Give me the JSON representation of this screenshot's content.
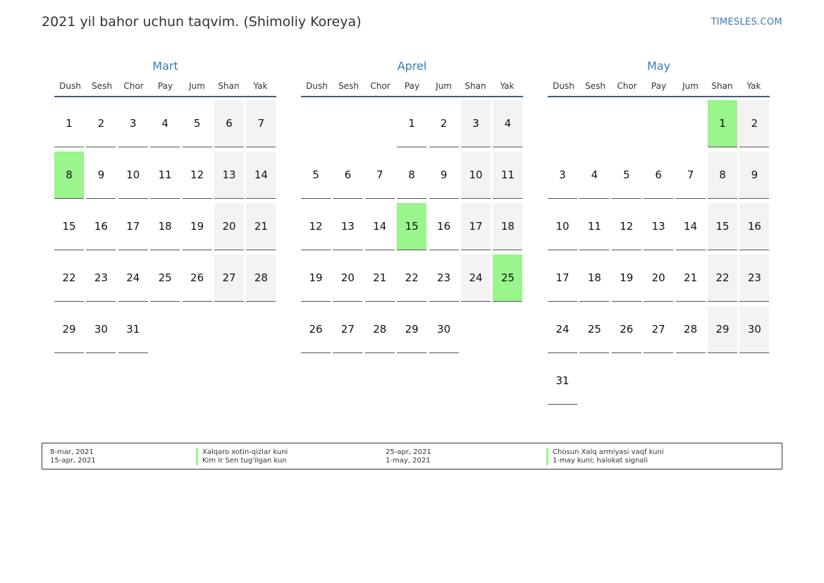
{
  "title": "2021 yil bahor uchun taqvim. (Shimoliy Koreya)",
  "site": "TIMESLES.COM",
  "colors": {
    "accent": "#3a7ab8",
    "holiday": "#99f58c",
    "weekend": "#f3f3f3"
  },
  "weekdays": [
    "Dush",
    "Sesh",
    "Chor",
    "Pay",
    "Jum",
    "Shan",
    "Yak"
  ],
  "months": [
    {
      "name": "Mart",
      "first_weekday": 0,
      "days": 31,
      "holidays": [
        8
      ]
    },
    {
      "name": "Aprel",
      "first_weekday": 3,
      "days": 30,
      "holidays": [
        15,
        25
      ]
    },
    {
      "name": "May",
      "first_weekday": 5,
      "days": 31,
      "holidays": [
        1
      ]
    }
  ],
  "legend": [
    {
      "date": "8-mar, 2021",
      "name": "Xalqaro xotin-qizlar kuni"
    },
    {
      "date": "15-apr, 2021",
      "name": "Kim Ir Sen tug'ilgan kun"
    },
    {
      "date": "25-apr, 2021",
      "name": "Chosun Xalq armiyasi vaqf kuni"
    },
    {
      "date": "1-may, 2021",
      "name": "1-may kuni; halokat signali"
    }
  ]
}
